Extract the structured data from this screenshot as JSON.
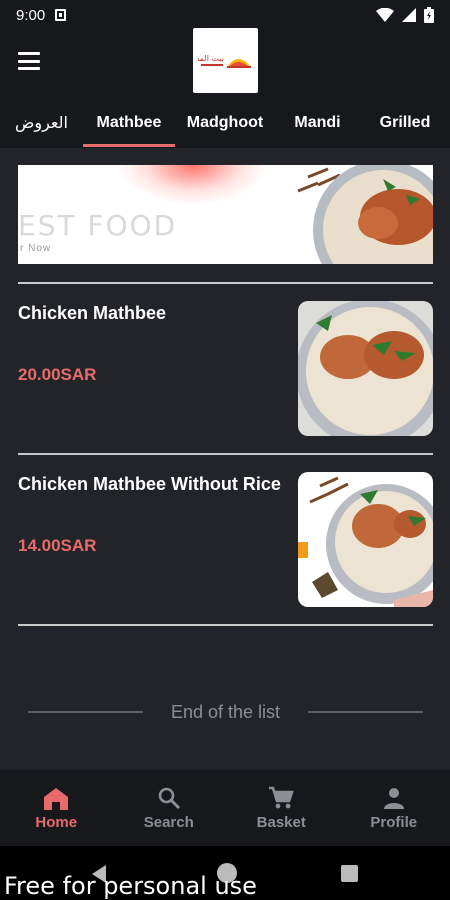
{
  "status_bar": {
    "time": "9:00"
  },
  "header": {
    "logo_text": "بيت المطبخ"
  },
  "tabs": [
    {
      "label": "العروض",
      "active": false
    },
    {
      "label": "Mathbee",
      "active": true
    },
    {
      "label": "Madghoot",
      "active": false
    },
    {
      "label": "Mandi",
      "active": false
    },
    {
      "label": "Grilled",
      "active": false
    }
  ],
  "banner": {
    "headline": "EST FOOD",
    "subline": "r Now"
  },
  "items": [
    {
      "name": "Chicken Mathbee",
      "price": "20.00SAR"
    },
    {
      "name": "Chicken Mathbee Without Rice",
      "price": "14.00SAR"
    }
  ],
  "end_of_list": "End of the list",
  "bottom_nav": [
    {
      "label": "Home",
      "icon": "home-icon",
      "active": true
    },
    {
      "label": "Search",
      "icon": "search-icon",
      "active": false
    },
    {
      "label": "Basket",
      "icon": "cart-icon",
      "active": false
    },
    {
      "label": "Profile",
      "icon": "person-icon",
      "active": false
    }
  ],
  "watermark": "Free for personal use",
  "colors": {
    "accent": "#e86b6b",
    "background": "#232429",
    "bar": "#17181b"
  }
}
